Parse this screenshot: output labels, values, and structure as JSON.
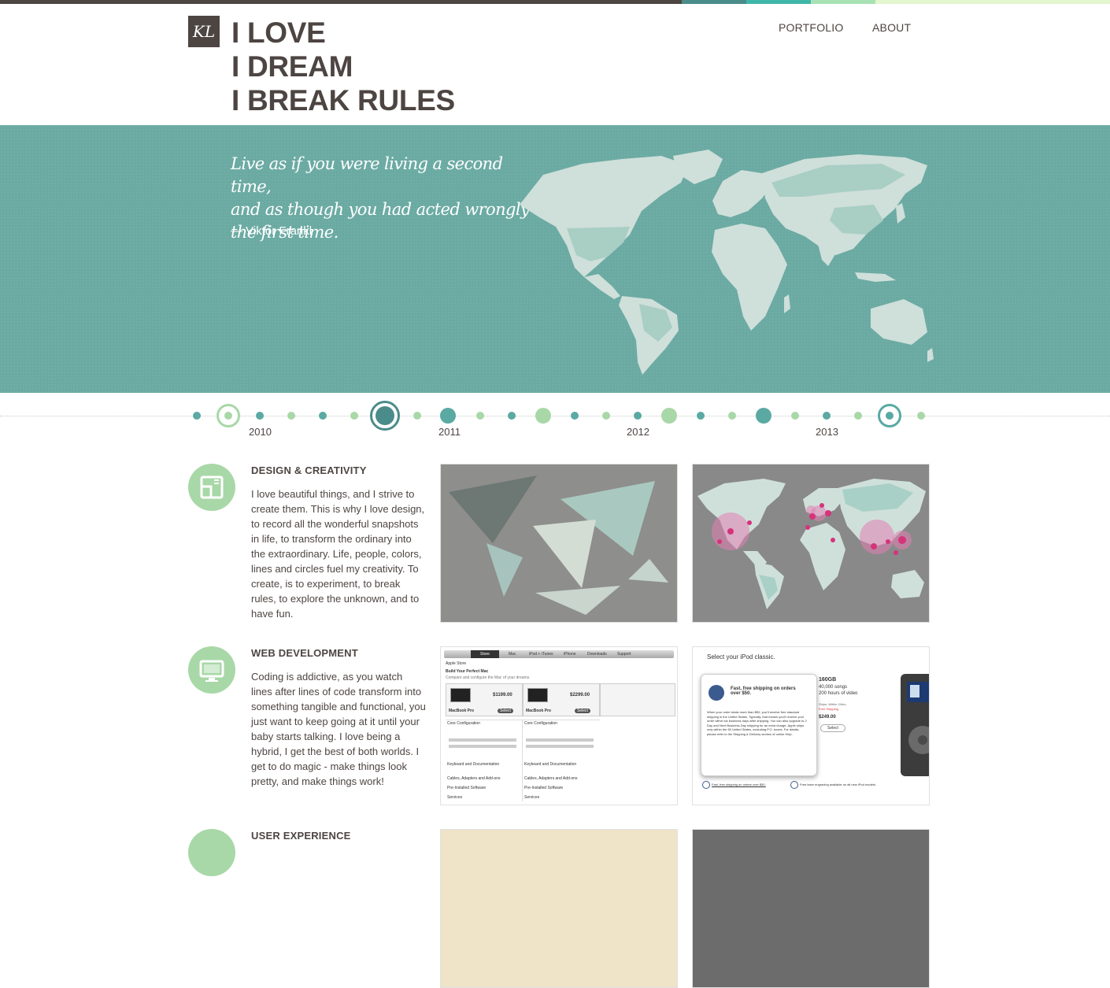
{
  "brand": {
    "logo_text": "KL",
    "tagline_lines": [
      "I LOVE",
      "I DREAM",
      "I BREAK RULES"
    ]
  },
  "nav": {
    "portfolio": "PORTFOLIO",
    "about": "ABOUT"
  },
  "colors": {
    "dark": "#4d4542",
    "teal": "#6aaaa2",
    "mint": "#a8d8a7",
    "dark_teal": "#4a8c89",
    "seafoam": "#5aa9a3"
  },
  "hero": {
    "quote_lines": [
      "Live as if you were living a second time,",
      "and as though you had acted wrongly",
      "the first time."
    ],
    "author": "— Viktor Frankl"
  },
  "timeline": {
    "years": [
      "2010",
      "2011",
      "2012",
      "2013"
    ]
  },
  "sections": [
    {
      "icon": "pencil-ruler-icon",
      "title": "DESIGN & CREATIVITY",
      "text": "I love beautiful things, and I strive to create them. This is why I love design, to record all the wonderful snapshots in life, to transform the ordinary into the extraordinary. Life, people, colors, lines and circles fuel my creativity. To create, is to experiment, to break rules, to explore the unknown, and to have fun."
    },
    {
      "icon": "monitor-icon",
      "title": "WEB DEVELOPMENT",
      "text": "Coding is addictive, as you watch lines after lines of code transform into something tangible and functional, you just want to keep going at it until your baby starts talking. I love being a hybrid, I get the best of both worlds. I get to do magic - make things look pretty, and make things work!"
    },
    {
      "icon": "user-experience-icon",
      "title": "USER EXPERIENCE"
    }
  ],
  "thumbs": {
    "mac": {
      "tabs": [
        "Store",
        "Mac",
        "iPod + iTunes",
        "iPhone",
        "Downloads",
        "Support"
      ],
      "store_label": "Apple Store",
      "heading": "Build Your Perfect Mac",
      "subheading": "Compare and configure the Mac of your dreams.",
      "price1": "$1199.00",
      "price2": "$2299.00",
      "model": "MacBook Pro",
      "select_label": "Select",
      "rows": [
        "Core Configuration",
        "Keyboard and Documentation",
        "Cables, Adapters and Add-ons",
        "Pre-Installed Software",
        "Services"
      ]
    },
    "ipod": {
      "title": "Select your iPod classic.",
      "capacity": "160GB",
      "songs": "40,000 songs",
      "video": "200 hours of video",
      "ships": "Ships: Within 24hrs",
      "free": "Free Shipping",
      "price": "$249.00",
      "select": "Select",
      "popup_title": "Fast, free shipping on orders over $50.",
      "popup_text": "When your order totals more than $50, you'll receive free standard shipping in the United States. Typically, that means you'll receive your order within six business days after shipping. You can also upgrade to 2 Day and Next Business Day shipping for an extra charge. Apple ships only within the 50 United States, excluding P.O. boxes. For details, please refer to the Shipping & Delivery section of online Help.",
      "footer1": "Fast, free shipping on orders over $50.",
      "footer2": "Free laser engraving available on all new iPod models."
    }
  }
}
